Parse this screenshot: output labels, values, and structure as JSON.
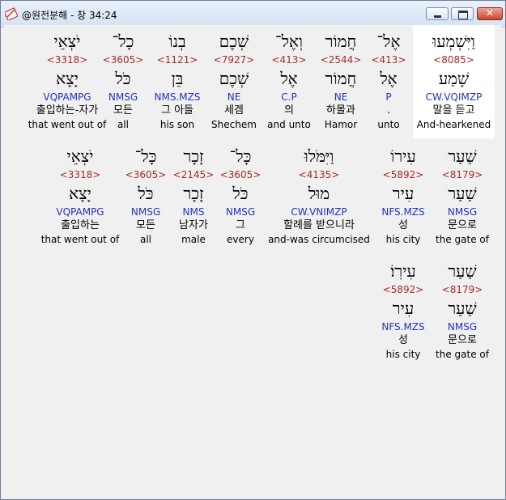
{
  "window": {
    "title": "@원전분해 - 창 34:24",
    "close_label": "✕"
  },
  "rows": [
    {
      "words": [
        {
          "heb": "יֹצְאֵי",
          "strong": "<3318>",
          "lemma": "יָצָא",
          "parse": "VQPAMPG",
          "kor": "출입하는-자가",
          "eng": "that went out of"
        },
        {
          "heb": "כָל־",
          "strong": "<3605>",
          "lemma": "כֹּל",
          "parse": "NMSG",
          "kor": "모든",
          "eng": "all"
        },
        {
          "heb": "בְנוֹ",
          "strong": "<1121>",
          "lemma": "בֵּן",
          "parse": "NMS.MZS",
          "kor": "그 아들",
          "eng": "his son"
        },
        {
          "heb": "שְׁכֶם",
          "strong": "<7927>",
          "lemma": "שְׁכֶם",
          "parse": "NE",
          "kor": "세겜",
          "eng": "Shechem"
        },
        {
          "heb": "וְאֶל־",
          "strong": "<413>",
          "lemma": "אֶל",
          "parse": "C.P",
          "kor": "의",
          "eng": "and unto"
        },
        {
          "heb": "חֲמוֹר",
          "strong": "<2544>",
          "lemma": "חֲמוֹר",
          "parse": "NE",
          "kor": "하몰과",
          "eng": "Hamor"
        },
        {
          "heb": "אֶל־",
          "strong": "<413>",
          "lemma": "אֶל",
          "parse": "P",
          "kor": ".",
          "eng": "unto"
        },
        {
          "heb": "וַיִּשְׁמְעוּ",
          "strong": "<8085>",
          "lemma": "שָׁמַע",
          "parse": "CW.VQIMZP",
          "kor": "말을 듣고",
          "eng": "And-hearkened"
        }
      ]
    },
    {
      "words": [
        {
          "heb": "יֹצְאֵי",
          "strong": "<3318>",
          "lemma": "יָצָא",
          "parse": "VQPAMPG",
          "kor": "출입하는",
          "eng": "that went out of"
        },
        {
          "heb": "כָּל־",
          "strong": "<3605>",
          "lemma": "כֹּל",
          "parse": "NMSG",
          "kor": "모든",
          "eng": "all"
        },
        {
          "heb": "זָכָר",
          "strong": "<2145>",
          "lemma": "זָכָר",
          "parse": "NMS",
          "kor": "남자가",
          "eng": "male"
        },
        {
          "heb": "כָּל־",
          "strong": "<3605>",
          "lemma": "כֹּל",
          "parse": "NMSG",
          "kor": "그",
          "eng": "every"
        },
        {
          "heb": "וַיִּמֹּלוּ",
          "strong": "<4135>",
          "lemma": "מוּל",
          "parse": "CW.VNIMZP",
          "kor": "할례를 받으니라",
          "eng": "and-was circumcised"
        },
        {
          "heb": "עִירוֹ",
          "strong": "<5892>",
          "lemma": "עִיר",
          "parse": "NFS.MZS",
          "kor": "성",
          "eng": "his city"
        },
        {
          "heb": "שַׁעַר",
          "strong": "<8179>",
          "lemma": "שַׁעַר",
          "parse": "NMSG",
          "kor": "문으로",
          "eng": "the gate of"
        }
      ]
    },
    {
      "words": [
        {
          "heb": "עִירֽוֹ׃",
          "strong": "<5892>",
          "lemma": "עִיר",
          "parse": "NFS.MZS",
          "kor": "성",
          "eng": "his city"
        },
        {
          "heb": "שַׁעַר",
          "strong": "<8179>",
          "lemma": "שַׁעַר",
          "parse": "NMSG",
          "kor": "문으로",
          "eng": "the gate of"
        }
      ]
    }
  ]
}
